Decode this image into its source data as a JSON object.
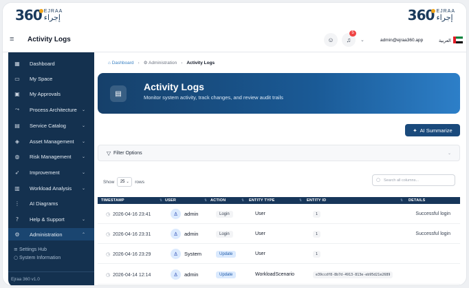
{
  "logo": {
    "number": "360",
    "en": "EJRAA",
    "ar": "إجراء"
  },
  "header": {
    "title": "Activity Logs",
    "notification_count": "5",
    "user_email": "admin@ejraa360.app",
    "language": "العربية"
  },
  "sidebar": {
    "items": [
      {
        "label": "Dashboard",
        "icon": "grid-icon",
        "glyph": "▦",
        "arrow": ""
      },
      {
        "label": "My Space",
        "icon": "folder-icon",
        "glyph": "▭",
        "arrow": ""
      },
      {
        "label": "My Approvals",
        "icon": "clipboard-icon",
        "glyph": "▣",
        "arrow": ""
      },
      {
        "label": "Process Architecture",
        "icon": "flow-icon",
        "glyph": "⤳",
        "arrow": "⌄"
      },
      {
        "label": "Service Catalog",
        "icon": "briefcase-icon",
        "glyph": "▤",
        "arrow": "⌄"
      },
      {
        "label": "Asset Management",
        "icon": "box-icon",
        "glyph": "◈",
        "arrow": "⌄"
      },
      {
        "label": "Risk Management",
        "icon": "shield-icon",
        "glyph": "◍",
        "arrow": "⌄"
      },
      {
        "label": "Improvement",
        "icon": "rocket-icon",
        "glyph": "➶",
        "arrow": "⌄"
      },
      {
        "label": "Workload Analysis",
        "icon": "document-icon",
        "glyph": "▥",
        "arrow": "⌄"
      },
      {
        "label": "AI Diagrams",
        "icon": "diagram-icon",
        "glyph": "⋮",
        "arrow": ""
      },
      {
        "label": "Help & Support",
        "icon": "help-icon",
        "glyph": "?",
        "arrow": "⌄"
      },
      {
        "label": "Administration",
        "icon": "gear-icon",
        "glyph": "⚙",
        "arrow": "⌃"
      }
    ],
    "subitems": [
      {
        "label": "Settings Hub",
        "glyph": "≡"
      },
      {
        "label": "System Information",
        "glyph": "○"
      }
    ],
    "version": "Ejraa 360 v1.0"
  },
  "breadcrumb": {
    "home": "Dashboard",
    "admin": "Administration",
    "current": "Activity Logs"
  },
  "hero": {
    "title": "Activity Logs",
    "subtitle": "Monitor system activity, track changes, and review audit trails"
  },
  "ai_summarize_label": "AI Summarize",
  "filter_label": "Filter Options",
  "table_controls": {
    "show": "Show",
    "page_size": "25",
    "rows": "rows",
    "search_placeholder": "Search all columns..."
  },
  "table": {
    "headers": [
      "TIMESTAMP",
      "USER",
      "ACTION",
      "ENTITY TYPE",
      "ENTITY ID",
      "DETAILS"
    ],
    "rows": [
      {
        "timestamp": "2026-04-16 23:41",
        "user": "admin",
        "action": "Login",
        "action_kind": "login",
        "entity_type": "User",
        "entity_id": "1",
        "details": "Successful login"
      },
      {
        "timestamp": "2026-04-16 23:31",
        "user": "admin",
        "action": "Login",
        "action_kind": "login",
        "entity_type": "User",
        "entity_id": "1",
        "details": "Successful login"
      },
      {
        "timestamp": "2026-04-16 23:29",
        "user": "System",
        "action": "Update",
        "action_kind": "update",
        "entity_type": "User",
        "entity_id": "1",
        "details": ""
      },
      {
        "timestamp": "2026-04-14 12:14",
        "user": "admin",
        "action": "Update",
        "action_kind": "update",
        "entity_type": "WorkloadScenario",
        "entity_id": "e39ccdf8-8b7d-4913-813e-eb95d21e2689",
        "details": ""
      }
    ]
  },
  "colors": {
    "sidebar_bg": "#14314f",
    "accent": "#1a4a7c",
    "badge": "#ef4444"
  }
}
